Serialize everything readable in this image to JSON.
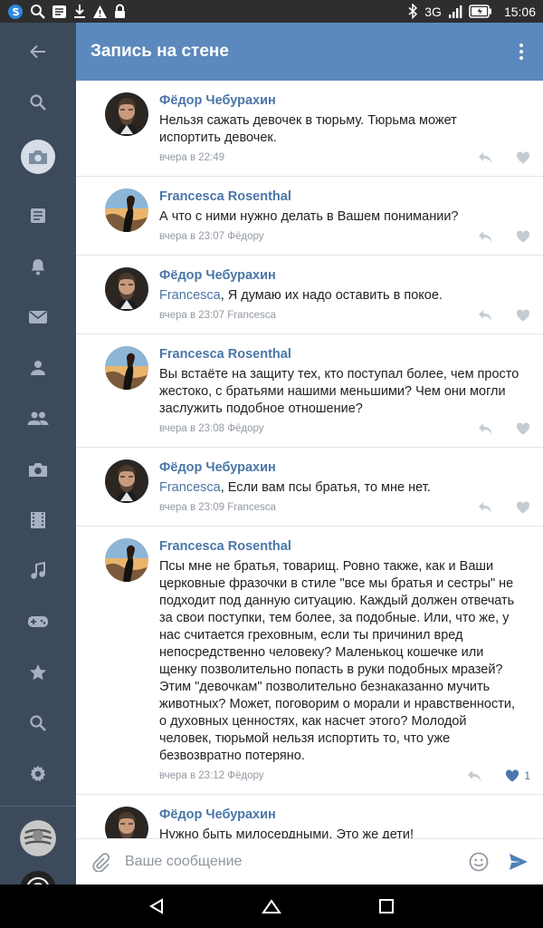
{
  "status_bar": {
    "network": "3G",
    "time": "15:06"
  },
  "header": {
    "title": "Запись на стене"
  },
  "comments": [
    {
      "author": "Фёдор Чебурахин",
      "avatar": "avatar-fedor",
      "reply_to": "",
      "text": "Нельзя сажать девочек в тюрьму. Тюрьма может испортить девочек.",
      "meta": "вчера в 22:49",
      "likes": ""
    },
    {
      "author": "Francesca Rosenthal",
      "avatar": "avatar-francesca",
      "reply_to": "",
      "text": "А что с ними нужно делать в Вашем понимании?",
      "meta": "вчера в 23:07 Фёдору",
      "likes": ""
    },
    {
      "author": "Фёдор Чебурахин",
      "avatar": "avatar-fedor",
      "reply_to": "Francesca",
      "text": ", Я думаю их надо оставить в покое.",
      "meta": "вчера в 23:07 Francesca",
      "likes": ""
    },
    {
      "author": "Francesca Rosenthal",
      "avatar": "avatar-francesca",
      "reply_to": "",
      "text": "Вы встаёте на защиту тех, кто поступал более, чем просто жестоко, с братьями нашими меньшими? Чем они могли заслужить подобное отношение?",
      "meta": "вчера в 23:08 Фёдору",
      "likes": ""
    },
    {
      "author": "Фёдор Чебурахин",
      "avatar": "avatar-fedor",
      "reply_to": "Francesca",
      "text": ", Если вам псы братья, то мне нет.",
      "meta": "вчера в 23:09 Francesca",
      "likes": ""
    },
    {
      "author": "Francesca Rosenthal",
      "avatar": "avatar-francesca",
      "reply_to": "",
      "text": "Псы мне не братья, товарищ. Ровно также, как и Ваши церковные фразочки в стиле \"все мы братья и сестры\" не подходит под данную ситуацию. Каждый должен отвечать за свои поступки, тем более, за подобные. Или, что же, у нас считается греховным, если ты причинил вред непосредственно человеку? Маленькоц кошечке или щенку позволительно попасть в руки подобных мразей? Этим \"девочкам\" позволительно безнаказанно мучить животных? Может, поговорим о морали и нравственности, о духовных ценностях, как насчет этого? Молодой человек, тюрьмой нельзя испортить то, что уже безвозвратно потеряно.",
      "meta": "вчера в 23:12 Фёдору",
      "likes": "1"
    },
    {
      "author": "Фёдор Чебурахин",
      "avatar": "avatar-fedor",
      "reply_to": "",
      "text": "Нужно быть милосердными. Это же дети!",
      "meta": "",
      "likes": ""
    }
  ],
  "composer": {
    "placeholder": "Ваше сообщение"
  },
  "colors": {
    "header": "#5b88bd",
    "sidebar": "#3d4a5c",
    "link": "#4a76a8",
    "meta": "#939aa3"
  },
  "sidebar_icons": [
    "back-arrow-icon",
    "search-icon",
    "camera-icon",
    "news-icon",
    "bell-icon",
    "mail-icon",
    "person-icon",
    "group-icon",
    "photo-icon",
    "film-icon",
    "music-icon",
    "gamepad-icon",
    "star-icon",
    "search-icon",
    "gear-icon"
  ]
}
